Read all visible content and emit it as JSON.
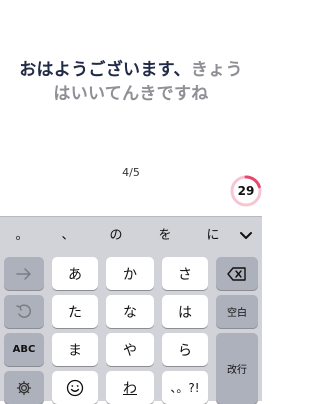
{
  "sentence": {
    "typed": "おはようございます、",
    "pending_line1": "きょう",
    "pending_line2": "はいいてんきですね"
  },
  "progress": "4/5",
  "timer": {
    "value": "29",
    "fraction": 0.2,
    "ring_color": "#e8486e",
    "track_color": "#f7c6d2"
  },
  "suggestions": [
    "。",
    "、",
    "の",
    "を",
    "に"
  ],
  "suggest_toggle_icon": "chevron-down-icon",
  "keys": {
    "row1": [
      "あ",
      "か",
      "さ"
    ],
    "row2": [
      "た",
      "な",
      "は"
    ],
    "row3": [
      "ま",
      "や",
      "ら"
    ],
    "wa": "わ",
    "punct": "、。?!",
    "abc": "ABC",
    "space": "空白",
    "enter": "改行"
  }
}
